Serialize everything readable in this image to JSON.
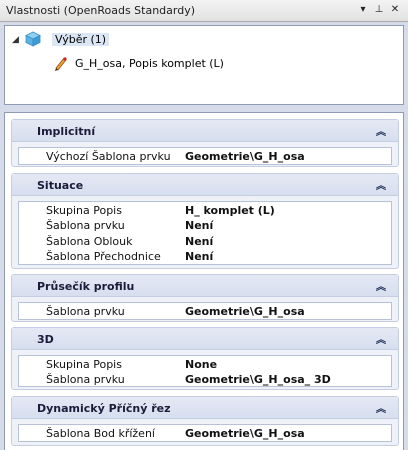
{
  "window": {
    "title": "Vlastnosti (OpenRoads Standardy)",
    "controls": [
      "▾",
      "⊥",
      "✕"
    ]
  },
  "tree": {
    "root_label": "Výběr (1)",
    "child_label": "G_H_osa, Popis komplet (L)"
  },
  "groups": [
    {
      "title": "Implicitní",
      "rows": [
        {
          "key": "Výchozí Šablona prvku",
          "value": "Geometrie\\G_H_osa"
        }
      ]
    },
    {
      "title": "Situace",
      "rows": [
        {
          "key": "Skupina Popis",
          "value": "H_ komplet (L)"
        },
        {
          "key": "Šablona prvku",
          "value": "Není"
        },
        {
          "key": "Šablona Oblouk",
          "value": "Není"
        },
        {
          "key": "Šablona Přechodnice",
          "value": "Není"
        }
      ]
    },
    {
      "title": "Průsečík profilu",
      "rows": [
        {
          "key": "Šablona prvku",
          "value": "Geometrie\\G_H_osa"
        }
      ]
    },
    {
      "title": "3D",
      "rows": [
        {
          "key": "Skupina Popis",
          "value": "None"
        },
        {
          "key": "Šablona prvku",
          "value": "Geometrie\\G_H_osa_ 3D"
        }
      ]
    },
    {
      "title": "Dynamický Příčný řez",
      "rows": [
        {
          "key": "Šablona Bod křížení",
          "value": "Geometrie\\G_H_osa"
        }
      ]
    }
  ]
}
